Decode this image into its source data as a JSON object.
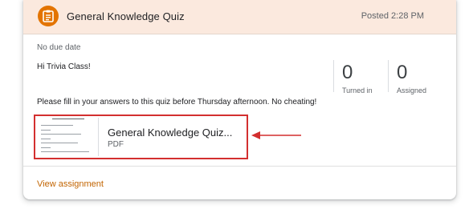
{
  "header": {
    "title": "General Knowledge Quiz",
    "posted": "Posted 2:28 PM",
    "icon": "assignment-icon",
    "accent": "#e37400"
  },
  "body": {
    "due": "No due date",
    "greeting": "Hi Trivia Class!",
    "instructions": "Please fill in your answers to this quiz before Thursday afternoon. No cheating!"
  },
  "stats": {
    "turned_in": {
      "value": "0",
      "label": "Turned in"
    },
    "assigned": {
      "value": "0",
      "label": "Assigned"
    }
  },
  "attachment": {
    "title": "General Knowledge Quiz...",
    "type": "PDF",
    "highlight_color": "#d32f2f"
  },
  "footer": {
    "link": "View assignment"
  }
}
